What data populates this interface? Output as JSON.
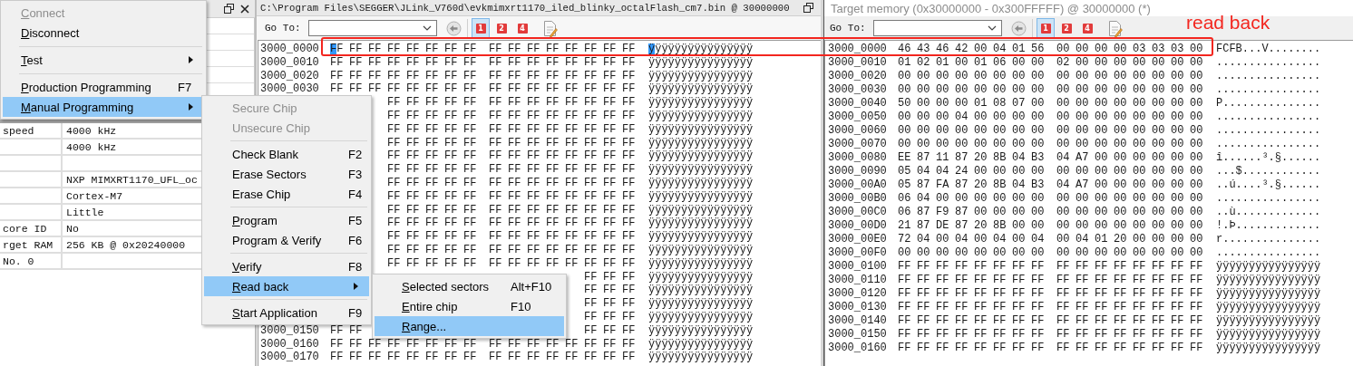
{
  "left_window": {
    "properties": [
      {
        "kind": "property",
        "name": "speed",
        "value": "4000 kHz"
      },
      {
        "kind": "property",
        "value": "4000 kHz"
      },
      {
        "kind": "blank"
      },
      {
        "kind": "property",
        "value": "NXP MIMXRT1170_UFL_oc"
      },
      {
        "kind": "property",
        "value": "Cortex-M7"
      },
      {
        "kind": "property",
        "value": "Little"
      },
      {
        "kind": "property",
        "name": "core ID",
        "value": "No"
      },
      {
        "kind": "property",
        "name": "rget RAM",
        "value": "256 KB @ 0x20240000"
      },
      {
        "kind": "property",
        "name": "No. 0"
      }
    ]
  },
  "hex_windows": [
    {
      "kind": "file",
      "title": "C:\\Program Files\\SEGGER\\JLink_V760d\\evkmimxrt1170_iled_blinky_octalFlash_cm7.bin @ 30000000",
      "active": true,
      "toolbar": {
        "goto_label": "Go To:",
        "view_buttons": [
          {
            "label": "1",
            "selected": true
          },
          {
            "label": "2",
            "selected": false
          },
          {
            "label": "4",
            "selected": false
          }
        ]
      },
      "rows": [
        {
          "address": "3000_0000",
          "bytes": [
            "FF",
            "FF",
            "FF",
            "FF",
            "FF",
            "FF",
            "FF",
            "FF",
            "FF",
            "FF",
            "FF",
            "FF",
            "FF",
            "FF",
            "FF",
            "FF"
          ],
          "ascii": "ÿÿÿÿÿÿÿÿÿÿÿÿÿÿÿÿ",
          "cursor": true
        },
        {
          "address": "3000_0010",
          "bytes": [
            "FF",
            "FF",
            "FF",
            "FF",
            "FF",
            "FF",
            "FF",
            "FF",
            "FF",
            "FF",
            "FF",
            "FF",
            "FF",
            "FF",
            "FF",
            "FF"
          ],
          "ascii": "ÿÿÿÿÿÿÿÿÿÿÿÿÿÿÿÿ",
          "cursor": false
        },
        {
          "address": "3000_0020",
          "bytes": [
            "FF",
            "FF",
            "FF",
            "FF",
            "FF",
            "FF",
            "FF",
            "FF",
            "FF",
            "FF",
            "FF",
            "FF",
            "FF",
            "FF",
            "FF",
            "FF"
          ],
          "ascii": "ÿÿÿÿÿÿÿÿÿÿÿÿÿÿÿÿ",
          "cursor": false
        },
        {
          "address": "3000_0030",
          "bytes": [
            "FF",
            "FF",
            "FF",
            "FF",
            "FF",
            "FF",
            "FF",
            "FF",
            "FF",
            "FF",
            "FF",
            "FF",
            "FF",
            "FF",
            "FF",
            "FF"
          ],
          "ascii": "ÿÿÿÿÿÿÿÿÿÿÿÿÿÿÿÿ",
          "cursor": false
        },
        {
          "tail_bytes": [
            "FF",
            "FF",
            "FF",
            "FF",
            "FF",
            "FF",
            "FF",
            "FF",
            "FF",
            "FF",
            "FF",
            "FF",
            "FF"
          ],
          "ascii": "ÿÿÿÿÿÿÿÿÿÿÿÿÿÿÿÿ",
          "cursor": false
        },
        {
          "tail_bytes": [
            "FF",
            "FF",
            "FF",
            "FF",
            "FF",
            "FF",
            "FF",
            "FF",
            "FF",
            "FF",
            "FF",
            "FF",
            "FF"
          ],
          "ascii": "ÿÿÿÿÿÿÿÿÿÿÿÿÿÿÿÿ",
          "cursor": false
        },
        {
          "tail_bytes": [
            "FF",
            "FF",
            "FF",
            "FF",
            "FF",
            "FF",
            "FF",
            "FF",
            "FF",
            "FF",
            "FF",
            "FF",
            "FF"
          ],
          "ascii": "ÿÿÿÿÿÿÿÿÿÿÿÿÿÿÿÿ",
          "cursor": false
        },
        {
          "tail_bytes": [
            "FF",
            "FF",
            "FF",
            "FF",
            "FF",
            "FF",
            "FF",
            "FF",
            "FF",
            "FF",
            "FF",
            "FF",
            "FF"
          ],
          "ascii": "ÿÿÿÿÿÿÿÿÿÿÿÿÿÿÿÿ",
          "cursor": false
        },
        {
          "tail_bytes": [
            "FF",
            "FF",
            "FF",
            "FF",
            "FF",
            "FF",
            "FF",
            "FF",
            "FF",
            "FF",
            "FF",
            "FF",
            "FF"
          ],
          "ascii": "ÿÿÿÿÿÿÿÿÿÿÿÿÿÿÿÿ",
          "cursor": false
        },
        {
          "tail_bytes": [
            "FF",
            "FF",
            "FF",
            "FF",
            "FF",
            "FF",
            "FF",
            "FF",
            "FF",
            "FF",
            "FF",
            "FF",
            "FF"
          ],
          "ascii": "ÿÿÿÿÿÿÿÿÿÿÿÿÿÿÿÿ",
          "cursor": false
        },
        {
          "tail_bytes": [
            "FF",
            "FF",
            "FF",
            "FF",
            "FF",
            "FF",
            "FF",
            "FF",
            "FF",
            "FF",
            "FF",
            "FF",
            "FF"
          ],
          "ascii": "ÿÿÿÿÿÿÿÿÿÿÿÿÿÿÿÿ",
          "cursor": false
        },
        {
          "tail_bytes": [
            "FF",
            "FF",
            "FF",
            "FF",
            "FF",
            "FF",
            "FF",
            "FF",
            "FF",
            "FF",
            "FF",
            "FF",
            "FF"
          ],
          "ascii": "ÿÿÿÿÿÿÿÿÿÿÿÿÿÿÿÿ",
          "cursor": false
        },
        {
          "tail_bytes": [
            "FF",
            "FF",
            "FF",
            "FF",
            "FF",
            "FF",
            "FF",
            "FF",
            "FF",
            "FF",
            "FF",
            "FF",
            "FF"
          ],
          "ascii": "ÿÿÿÿÿÿÿÿÿÿÿÿÿÿÿÿ",
          "cursor": false
        },
        {
          "tail_bytes": [
            "FF",
            "FF",
            "FF",
            "FF",
            "FF",
            "FF",
            "FF",
            "FF",
            "FF",
            "FF",
            "FF",
            "FF",
            "FF"
          ],
          "ascii": "ÿÿÿÿÿÿÿÿÿÿÿÿÿÿÿÿ",
          "cursor": false
        },
        {
          "tail_bytes": [
            "FF",
            "FF",
            "FF",
            "FF",
            "FF",
            "FF",
            "FF",
            "FF",
            "FF",
            "FF",
            "FF",
            "FF",
            "FF"
          ],
          "ascii": "ÿÿÿÿÿÿÿÿÿÿÿÿÿÿÿÿ",
          "cursor": false
        },
        {
          "tail_bytes": [
            "FF",
            "FF",
            "FF",
            "FF",
            "FF",
            "FF",
            "FF",
            "FF",
            "FF",
            "FF",
            "FF",
            "FF",
            "FF"
          ],
          "ascii": "ÿÿÿÿÿÿÿÿÿÿÿÿÿÿÿÿ",
          "cursor": false
        },
        {
          "tail_bytes": [
            "FF",
            "FF",
            "FF",
            "FF",
            "FF",
            "FF",
            "FF",
            "FF",
            "FF",
            "FF",
            "FF",
            "FF",
            "FF"
          ],
          "ascii": "ÿÿÿÿÿÿÿÿÿÿÿÿÿÿÿÿ",
          "cursor": false
        },
        {
          "tail_bytes": [
            "FF",
            "FF",
            "FF"
          ],
          "ascii": "ÿÿÿÿÿÿÿÿÿÿÿÿÿÿÿÿ",
          "cursor": false
        },
        {
          "tail_bytes": [
            "FF",
            "FF",
            "FF"
          ],
          "ascii": "ÿÿÿÿÿÿÿÿÿÿÿÿÿÿÿÿ",
          "cursor": false
        },
        {
          "tail_bytes": [
            "FF",
            "FF",
            "FF"
          ],
          "ascii": "ÿÿÿÿÿÿÿÿÿÿÿÿÿÿÿÿ",
          "cursor": false
        },
        {
          "tail_bytes": [
            "FF",
            "FF",
            "FF"
          ],
          "ascii": "ÿÿÿÿÿÿÿÿÿÿÿÿÿÿÿÿ",
          "cursor": false
        },
        {
          "address": "3000_0150",
          "bytes": [
            "FF",
            "FF"
          ],
          "tail_bytes": [
            "FF",
            "FF",
            "FF"
          ],
          "ascii": "ÿÿÿÿÿÿÿÿÿÿÿÿÿÿÿÿ",
          "cursor": false
        },
        {
          "address": "3000_0160",
          "bytes": [
            "FF",
            "FF",
            "FF",
            "FF",
            "FF",
            "FF",
            "FF",
            "FF",
            "FF",
            "FF",
            "FF",
            "FF",
            "FF",
            "FF",
            "FF",
            "FF"
          ],
          "ascii": "ÿÿÿÿÿÿÿÿÿÿÿÿÿÿÿÿ",
          "cursor": false
        },
        {
          "address": "3000_0170",
          "bytes": [
            "FF",
            "FF",
            "FF",
            "FF",
            "FF",
            "FF",
            "FF",
            "FF",
            "FF",
            "FF",
            "FF",
            "FF",
            "FF",
            "FF",
            "FF",
            "FF"
          ],
          "ascii": "ÿÿÿÿÿÿÿÿÿÿÿÿÿÿÿÿ",
          "cursor": false
        }
      ]
    },
    {
      "kind": "target",
      "title": "Target memory (0x30000000 - 0x300FFFFF) @ 30000000 (*)",
      "active": false,
      "toolbar": {
        "goto_label": "Go To:",
        "view_buttons": [
          {
            "label": "1",
            "selected": true
          },
          {
            "label": "2",
            "selected": false
          },
          {
            "label": "4",
            "selected": false
          }
        ]
      },
      "rows": [
        {
          "address": "3000_0000",
          "bytes": [
            "46",
            "43",
            "46",
            "42",
            "00",
            "04",
            "01",
            "56",
            "00",
            "00",
            "00",
            "00",
            "03",
            "03",
            "03",
            "00"
          ],
          "ascii": "FCFB...V........",
          "cursor": false
        },
        {
          "address": "3000_0010",
          "bytes": [
            "01",
            "02",
            "01",
            "00",
            "01",
            "06",
            "00",
            "00",
            "02",
            "00",
            "00",
            "00",
            "00",
            "00",
            "00",
            "00"
          ],
          "ascii": "................",
          "cursor": false
        },
        {
          "address": "3000_0020",
          "bytes": [
            "00",
            "00",
            "00",
            "00",
            "00",
            "00",
            "00",
            "00",
            "00",
            "00",
            "00",
            "00",
            "00",
            "00",
            "00",
            "00"
          ],
          "ascii": "................",
          "cursor": false
        },
        {
          "address": "3000_0030",
          "bytes": [
            "00",
            "00",
            "00",
            "00",
            "00",
            "00",
            "00",
            "00",
            "00",
            "00",
            "00",
            "00",
            "00",
            "00",
            "00",
            "00"
          ],
          "ascii": "................",
          "cursor": false
        },
        {
          "address": "3000_0040",
          "bytes": [
            "50",
            "00",
            "00",
            "00",
            "01",
            "08",
            "07",
            "00",
            "00",
            "00",
            "00",
            "00",
            "00",
            "00",
            "00",
            "00"
          ],
          "ascii": "P...............",
          "cursor": false
        },
        {
          "address": "3000_0050",
          "bytes": [
            "00",
            "00",
            "00",
            "04",
            "00",
            "00",
            "00",
            "00",
            "00",
            "00",
            "00",
            "00",
            "00",
            "00",
            "00",
            "00"
          ],
          "ascii": "................",
          "cursor": false
        },
        {
          "address": "3000_0060",
          "bytes": [
            "00",
            "00",
            "00",
            "00",
            "00",
            "00",
            "00",
            "00",
            "00",
            "00",
            "00",
            "00",
            "00",
            "00",
            "00",
            "00"
          ],
          "ascii": "................",
          "cursor": false
        },
        {
          "address": "3000_0070",
          "bytes": [
            "00",
            "00",
            "00",
            "00",
            "00",
            "00",
            "00",
            "00",
            "00",
            "00",
            "00",
            "00",
            "00",
            "00",
            "00",
            "00"
          ],
          "ascii": "................",
          "cursor": false
        },
        {
          "address": "3000_0080",
          "bytes": [
            "EE",
            "87",
            "11",
            "87",
            "20",
            "8B",
            "04",
            "B3",
            "04",
            "A7",
            "00",
            "00",
            "00",
            "00",
            "00",
            "00"
          ],
          "ascii": "î......³.§......",
          "cursor": false
        },
        {
          "address": "3000_0090",
          "bytes": [
            "05",
            "04",
            "04",
            "24",
            "00",
            "00",
            "00",
            "00",
            "00",
            "00",
            "00",
            "00",
            "00",
            "00",
            "00",
            "00"
          ],
          "ascii": "...$............",
          "cursor": false
        },
        {
          "address": "3000_00A0",
          "bytes": [
            "05",
            "87",
            "FA",
            "87",
            "20",
            "8B",
            "04",
            "B3",
            "04",
            "A7",
            "00",
            "00",
            "00",
            "00",
            "00",
            "00"
          ],
          "ascii": "..ú....³.§......",
          "cursor": false
        },
        {
          "address": "3000_00B0",
          "bytes": [
            "06",
            "04",
            "00",
            "00",
            "00",
            "00",
            "00",
            "00",
            "00",
            "00",
            "00",
            "00",
            "00",
            "00",
            "00",
            "00"
          ],
          "ascii": "................",
          "cursor": false
        },
        {
          "address": "3000_00C0",
          "bytes": [
            "06",
            "87",
            "F9",
            "87",
            "00",
            "00",
            "00",
            "00",
            "00",
            "00",
            "00",
            "00",
            "00",
            "00",
            "00",
            "00"
          ],
          "ascii": "..ù.............",
          "cursor": false
        },
        {
          "address": "3000_00D0",
          "bytes": [
            "21",
            "87",
            "DE",
            "87",
            "20",
            "8B",
            "00",
            "00",
            "00",
            "00",
            "00",
            "00",
            "00",
            "00",
            "00",
            "00"
          ],
          "ascii": "!.Þ.............",
          "cursor": false
        },
        {
          "address": "3000_00E0",
          "bytes": [
            "72",
            "04",
            "00",
            "04",
            "00",
            "04",
            "00",
            "04",
            "00",
            "04",
            "01",
            "20",
            "00",
            "00",
            "00",
            "00"
          ],
          "ascii": "r...............",
          "cursor": false
        },
        {
          "address": "3000_00F0",
          "bytes": [
            "00",
            "00",
            "00",
            "00",
            "00",
            "00",
            "00",
            "00",
            "00",
            "00",
            "00",
            "00",
            "00",
            "00",
            "00",
            "00"
          ],
          "ascii": "................",
          "cursor": false
        },
        {
          "address": "3000_0100",
          "bytes": [
            "FF",
            "FF",
            "FF",
            "FF",
            "FF",
            "FF",
            "FF",
            "FF",
            "FF",
            "FF",
            "FF",
            "FF",
            "FF",
            "FF",
            "FF",
            "FF"
          ],
          "ascii": "ÿÿÿÿÿÿÿÿÿÿÿÿÿÿÿÿ",
          "cursor": false
        },
        {
          "address": "3000_0110",
          "bytes": [
            "FF",
            "FF",
            "FF",
            "FF",
            "FF",
            "FF",
            "FF",
            "FF",
            "FF",
            "FF",
            "FF",
            "FF",
            "FF",
            "FF",
            "FF",
            "FF"
          ],
          "ascii": "ÿÿÿÿÿÿÿÿÿÿÿÿÿÿÿÿ",
          "cursor": false
        },
        {
          "address": "3000_0120",
          "bytes": [
            "FF",
            "FF",
            "FF",
            "FF",
            "FF",
            "FF",
            "FF",
            "FF",
            "FF",
            "FF",
            "FF",
            "FF",
            "FF",
            "FF",
            "FF",
            "FF"
          ],
          "ascii": "ÿÿÿÿÿÿÿÿÿÿÿÿÿÿÿÿ",
          "cursor": false
        },
        {
          "address": "3000_0130",
          "bytes": [
            "FF",
            "FF",
            "FF",
            "FF",
            "FF",
            "FF",
            "FF",
            "FF",
            "FF",
            "FF",
            "FF",
            "FF",
            "FF",
            "FF",
            "FF",
            "FF"
          ],
          "ascii": "ÿÿÿÿÿÿÿÿÿÿÿÿÿÿÿÿ",
          "cursor": false
        },
        {
          "address": "3000_0140",
          "bytes": [
            "FF",
            "FF",
            "FF",
            "FF",
            "FF",
            "FF",
            "FF",
            "FF",
            "FF",
            "FF",
            "FF",
            "FF",
            "FF",
            "FF",
            "FF",
            "FF"
          ],
          "ascii": "ÿÿÿÿÿÿÿÿÿÿÿÿÿÿÿÿ",
          "cursor": false
        },
        {
          "address": "3000_0150",
          "bytes": [
            "FF",
            "FF",
            "FF",
            "FF",
            "FF",
            "FF",
            "FF",
            "FF",
            "FF",
            "FF",
            "FF",
            "FF",
            "FF",
            "FF",
            "FF",
            "FF"
          ],
          "ascii": "ÿÿÿÿÿÿÿÿÿÿÿÿÿÿÿÿ",
          "cursor": false
        },
        {
          "address": "3000_0160",
          "bytes": [
            "FF",
            "FF",
            "FF",
            "FF",
            "FF",
            "FF",
            "FF",
            "FF",
            "FF",
            "FF",
            "FF",
            "FF",
            "FF",
            "FF",
            "FF",
            "FF"
          ],
          "ascii": "ÿÿÿÿÿÿÿÿÿÿÿÿÿÿÿÿ",
          "cursor": false
        }
      ]
    }
  ],
  "menus": [
    {
      "items": [
        {
          "kind": "item",
          "label": "Connect",
          "disabled": true,
          "selected": false,
          "submenu": false,
          "mnemonic": true
        },
        {
          "kind": "item",
          "label": "Disconnect",
          "disabled": false,
          "selected": false,
          "submenu": false,
          "mnemonic": true
        },
        {
          "kind": "separator"
        },
        {
          "kind": "item",
          "label": "Test",
          "disabled": false,
          "selected": false,
          "submenu": true,
          "mnemonic": true
        },
        {
          "kind": "separator"
        },
        {
          "kind": "item",
          "label": "Production Programming",
          "shortcut": "F7",
          "disabled": false,
          "selected": false,
          "submenu": false,
          "mnemonic": true
        },
        {
          "kind": "item",
          "label": "Manual Programming",
          "disabled": false,
          "selected": true,
          "submenu": true,
          "mnemonic": true
        }
      ]
    },
    {
      "items": [
        {
          "kind": "item",
          "label": "Secure Chip",
          "disabled": true,
          "selected": false,
          "submenu": false,
          "mnemonic": false
        },
        {
          "kind": "item",
          "label": "Unsecure Chip",
          "disabled": true,
          "selected": false,
          "submenu": false,
          "mnemonic": false
        },
        {
          "kind": "separator"
        },
        {
          "kind": "item",
          "label": "Check Blank",
          "shortcut": "F2",
          "disabled": false,
          "selected": false,
          "submenu": false,
          "mnemonic": false
        },
        {
          "kind": "item",
          "label": "Erase Sectors",
          "shortcut": "F3",
          "disabled": false,
          "selected": false,
          "submenu": false,
          "mnemonic": false
        },
        {
          "kind": "item",
          "label": "Erase Chip",
          "shortcut": "F4",
          "disabled": false,
          "selected": false,
          "submenu": false,
          "mnemonic": false
        },
        {
          "kind": "separator"
        },
        {
          "kind": "item",
          "label": "Program",
          "shortcut": "F5",
          "disabled": false,
          "selected": false,
          "submenu": false,
          "mnemonic": true
        },
        {
          "kind": "item",
          "label": "Program & Verify",
          "shortcut": "F6",
          "disabled": false,
          "selected": false,
          "submenu": false,
          "mnemonic": false
        },
        {
          "kind": "separator"
        },
        {
          "kind": "item",
          "label": "Verify",
          "shortcut": "F8",
          "disabled": false,
          "selected": false,
          "submenu": false,
          "mnemonic": true
        },
        {
          "kind": "item",
          "label": "Read back",
          "disabled": false,
          "selected": true,
          "submenu": true,
          "mnemonic": true
        },
        {
          "kind": "separator"
        },
        {
          "kind": "item",
          "label": "Start Application",
          "shortcut": "F9",
          "disabled": false,
          "selected": false,
          "submenu": false,
          "mnemonic": true
        }
      ]
    },
    {
      "items": [
        {
          "kind": "item",
          "label": "Selected sectors",
          "shortcut": "Alt+F10",
          "disabled": false,
          "selected": false,
          "submenu": false,
          "mnemonic": true
        },
        {
          "kind": "item",
          "label": "Entire chip",
          "shortcut": "F10",
          "disabled": false,
          "selected": false,
          "submenu": false,
          "mnemonic": true
        },
        {
          "kind": "item",
          "label": "Range...",
          "disabled": false,
          "selected": true,
          "submenu": false,
          "mnemonic": true
        }
      ]
    }
  ],
  "annotation": {
    "text": "read back"
  }
}
